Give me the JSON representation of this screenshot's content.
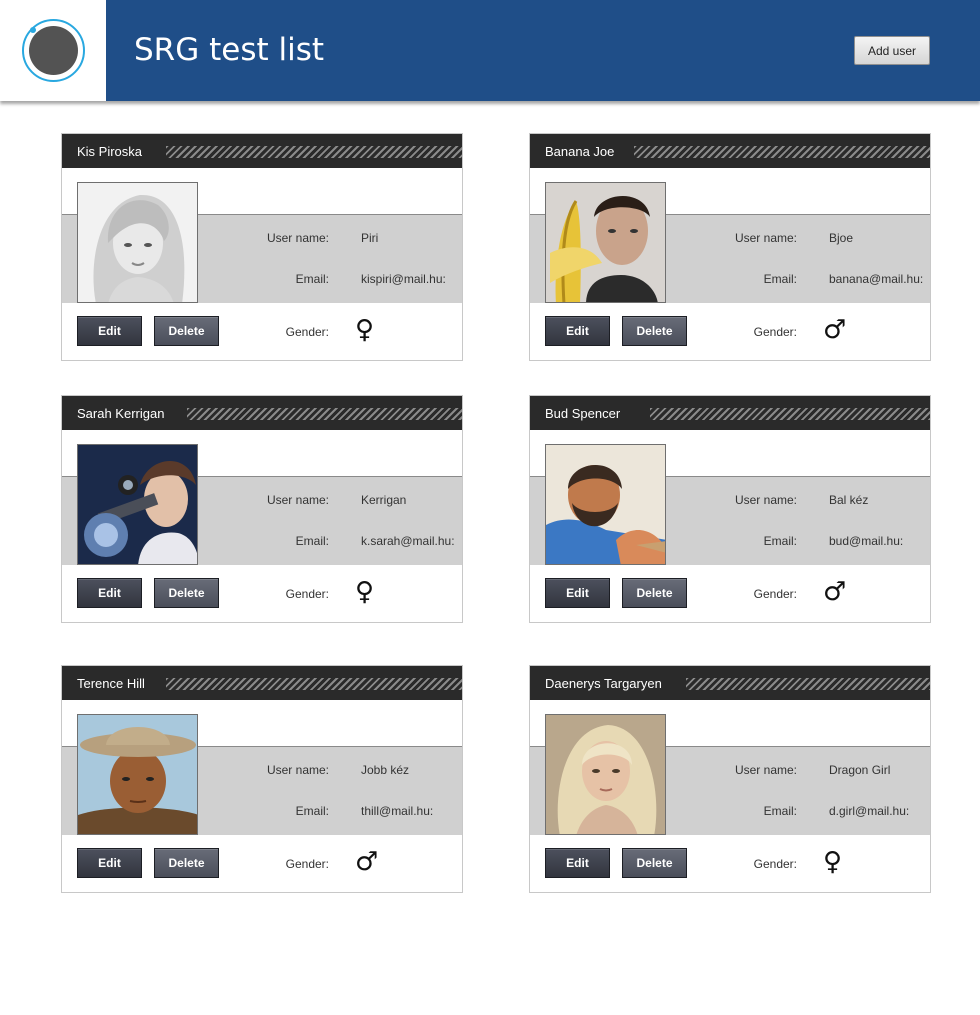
{
  "header": {
    "title": "SRG test list",
    "add_user_label": "Add user",
    "brand_color": "#1f4e88",
    "logo_icon": "circle-logo-icon"
  },
  "labels": {
    "username": "User name:",
    "email": "Email:",
    "gender": "Gender:",
    "edit": "Edit",
    "delete": "Delete"
  },
  "users": [
    {
      "name": "Kis Piroska",
      "username": "Piri",
      "email": "kispiri@mail.hu:",
      "gender": "♀",
      "gender_icon": "female-icon",
      "photo": "grayscale-portrait-woman"
    },
    {
      "name": "Banana Joe",
      "username": "Bjoe",
      "email": "banana@mail.hu:",
      "gender": "♂",
      "gender_icon": "male-icon",
      "photo": "man-holding-banana"
    },
    {
      "name": "Sarah Kerrigan",
      "username": "Kerrigan",
      "email": "k.sarah@mail.hu:",
      "gender": "♀",
      "gender_icon": "female-icon",
      "photo": "woman-with-rifle-scope"
    },
    {
      "name": "Bud Spencer",
      "username": "Bal kéz",
      "email": "bud@mail.hu:",
      "gender": "♂",
      "gender_icon": "male-icon",
      "photo": "bearded-man-painting"
    },
    {
      "name": "Terence Hill",
      "username": "Jobb kéz",
      "email": "thill@mail.hu:",
      "gender": "♂",
      "gender_icon": "male-icon",
      "photo": "man-in-cowboy-hat"
    },
    {
      "name": "Daenerys Targaryen",
      "username": "Dragon Girl",
      "email": "d.girl@mail.hu:",
      "gender": "♀",
      "gender_icon": "female-icon",
      "photo": "blonde-woman-portrait"
    }
  ]
}
